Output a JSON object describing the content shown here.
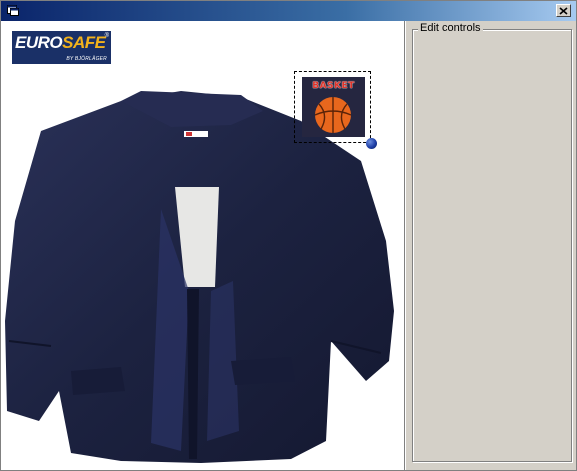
{
  "window": {
    "title": ""
  },
  "logo": {
    "brand_part1": "EURO",
    "brand_part2": "SAFE",
    "registered_mark": "®",
    "tagline": "BY BJÖRLÄGER"
  },
  "patch": {
    "text": "BASKET"
  },
  "panel": {
    "group_label": "Edit controls"
  },
  "titlebar": {
    "close_glyph": "✕"
  },
  "colors": {
    "titlebar_active": "#0a246a",
    "panel_background": "#d4d0c8",
    "jacket": "#1f2545",
    "selection_handle": "#1e3ea6"
  },
  "icons": {
    "app": "app-window-icon",
    "close": "close-icon",
    "handle": "resize-handle-icon"
  }
}
